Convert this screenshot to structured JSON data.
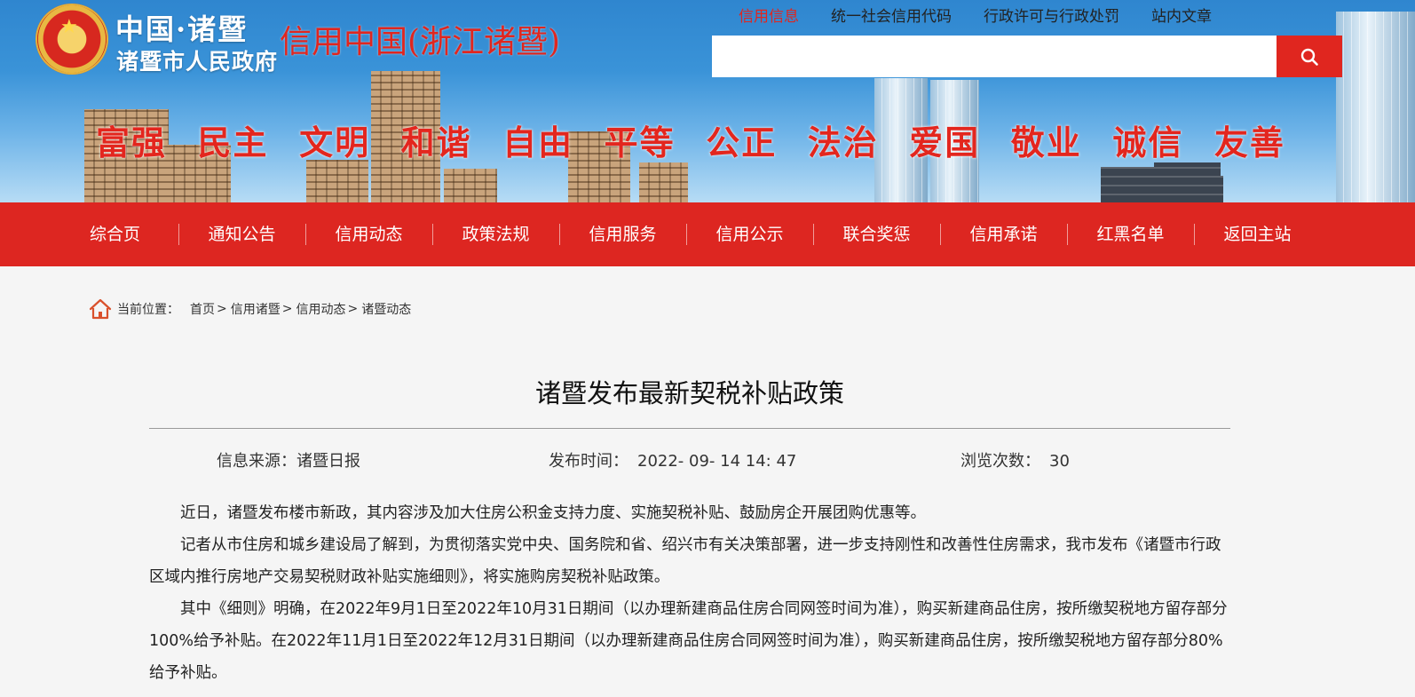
{
  "header": {
    "logo_line1": "中国·诸暨",
    "logo_line2": "诸暨市人民政府",
    "site_title": "信用中国(浙江诸暨)",
    "top_links": [
      "信用信息",
      "统一社会信用代码",
      "行政许可与行政处罚",
      "站内文章"
    ],
    "search": {
      "value": "",
      "placeholder": ""
    },
    "values": [
      "富强",
      "民主",
      "文明",
      "和谐",
      "自由",
      "平等",
      "公正",
      "法治",
      "爱国",
      "敬业",
      "诚信",
      "友善"
    ],
    "accent_color": "#e0261f"
  },
  "nav": {
    "items": [
      "综合页",
      "通知公告",
      "信用动态",
      "政策法规",
      "信用服务",
      "信用公示",
      "联合奖惩",
      "信用承诺",
      "红黑名单",
      "返回主站"
    ]
  },
  "breadcrumb": {
    "label": "当前位置：",
    "items": [
      "首页",
      "信用诸暨",
      "信用动态",
      "诸暨动态"
    ],
    "separator": ">"
  },
  "article": {
    "title": "诸暨发布最新契税补贴政策",
    "source_label": "信息来源：",
    "source_value": "诸暨日报",
    "time_label": "发布时间：",
    "time_value": "2022- 09- 14 14: 47",
    "views_label": "浏览次数：",
    "views_value": "30",
    "paragraphs": [
      "近日，诸暨发布楼市新政，其内容涉及加大住房公积金支持力度、实施契税补贴、鼓励房企开展团购优惠等。",
      "记者从市住房和城乡建设局了解到，为贯彻落实党中央、国务院和省、绍兴市有关决策部署，进一步支持刚性和改善性住房需求，我市发布《诸暨市行政区域内推行房地产交易契税财政补贴实施细则》，将实施购房契税补贴政策。",
      "其中《细则》明确，在2022年9月1日至2022年10月31日期间（以办理新建商品住房合同网签时间为准），购买新建商品住房，按所缴契税地方留存部分100%给予补贴。在2022年11月1日至2022年12月31日期间（以办理新建商品住房合同网签时间为准），购买新建商品住房，按所缴契税地方留存部分80%给予补贴。"
    ]
  }
}
